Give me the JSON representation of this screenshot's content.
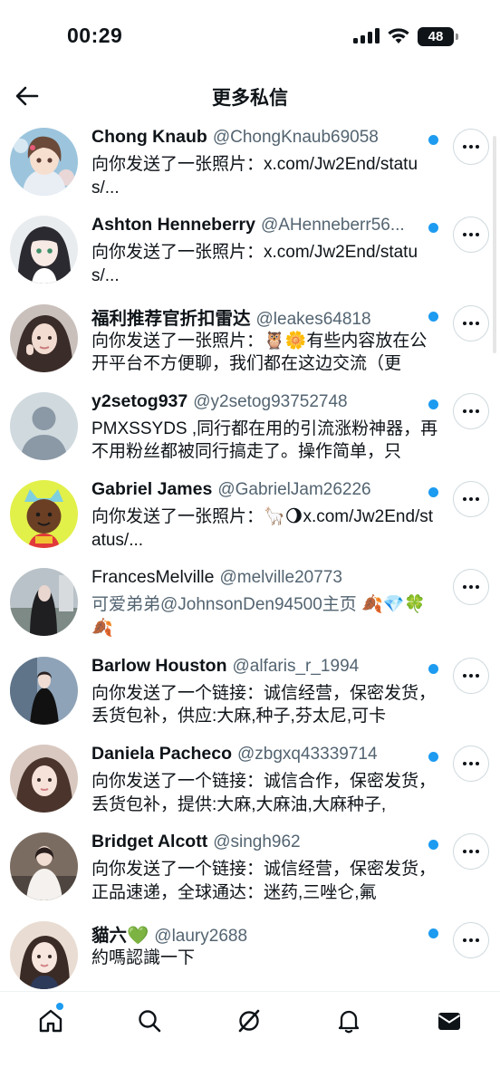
{
  "status_bar": {
    "time": "00:29",
    "battery": "48"
  },
  "header": {
    "title": "更多私信"
  },
  "conversations": [
    {
      "name": "Chong Knaub",
      "handle": "@ChongKnaub69058",
      "snippet": "向你发送了一张照片：x.com/Jw2End/status/...",
      "unread": true,
      "avatar": "anime-girl-avatar",
      "name_weight": "bold"
    },
    {
      "name": "Ashton Henneberry",
      "handle": "@AHenneberr56...",
      "snippet": "向你发送了一张照片：x.com/Jw2End/status/...",
      "unread": true,
      "avatar": "anime-girl-dark-hair-avatar",
      "name_weight": "bold"
    },
    {
      "name": "福利推荐官折扣雷达",
      "handle": "@leakes64818",
      "snippet": "向你发送了一张照片：🦉🌼有些内容放在公开平台不方便聊，我们都在这边交流（更",
      "unread": true,
      "avatar": "woman-photo-avatar",
      "name_weight": "bold"
    },
    {
      "name": "y2setog937",
      "handle": "@y2setog93752748",
      "snippet": "PMXSSYDS ,同行都在用的引流涨粉神器，再不用粉丝都被同行搞走了。操作简单，只",
      "unread": true,
      "avatar": "default-person-avatar",
      "name_weight": "bold"
    },
    {
      "name": "Gabriel James",
      "handle": "@GabrielJam26226",
      "snippet": "向你发送了一张照片：🦙🌖x.com/Jw2End/status/...",
      "unread": true,
      "avatar": "cartoon-face-avatar",
      "name_weight": "bold"
    },
    {
      "name": "FrancesMelville",
      "handle": "@melville20773",
      "snippet": "可爱弟弟@JohnsonDen94500主页 🍂💎🍀🍂",
      "unread": false,
      "avatar": "woman-street-avatar",
      "name_weight": "regular"
    },
    {
      "name": "Barlow Houston",
      "handle": "@alfaris_r_1994",
      "snippet": "向你发送了一个链接：诚信经营，保密发货，丢货包补，供应:大麻,种子,芬太尼,可卡",
      "unread": true,
      "avatar": "woman-office-avatar",
      "name_weight": "bold"
    },
    {
      "name": "Daniela Pacheco",
      "handle": "@zbgxq43339714",
      "snippet": "向你发送了一个链接：诚信合作，保密发货，丢货包补，提供:大麻,大麻油,大麻种子,",
      "unread": true,
      "avatar": "woman-selfie-avatar",
      "name_weight": "bold"
    },
    {
      "name": "Bridget Alcott",
      "handle": "@singh962",
      "snippet": "向你发送了一个链接：诚信经营，保密发货，正品速递，全球通达：迷药,三唑仑,氟",
      "unread": true,
      "avatar": "woman-sofa-avatar",
      "name_weight": "bold"
    },
    {
      "name": "貓六💚",
      "handle": "@laury2688",
      "snippet": "約嗎認識一下",
      "unread": true,
      "avatar": "woman-portrait-avatar",
      "name_weight": "bold"
    }
  ],
  "bottom_nav": [
    {
      "name": "home",
      "icon": "home-icon",
      "badge": true
    },
    {
      "name": "search",
      "icon": "search-icon",
      "badge": false
    },
    {
      "name": "grok",
      "icon": "grok-icon",
      "badge": false
    },
    {
      "name": "notifications",
      "icon": "bell-icon",
      "badge": false
    },
    {
      "name": "messages",
      "icon": "mail-icon",
      "badge": false
    }
  ],
  "colors": {
    "accent": "#1d9bf0",
    "text": "#0f1419",
    "secondary": "#536471",
    "border": "#cfd9de"
  }
}
